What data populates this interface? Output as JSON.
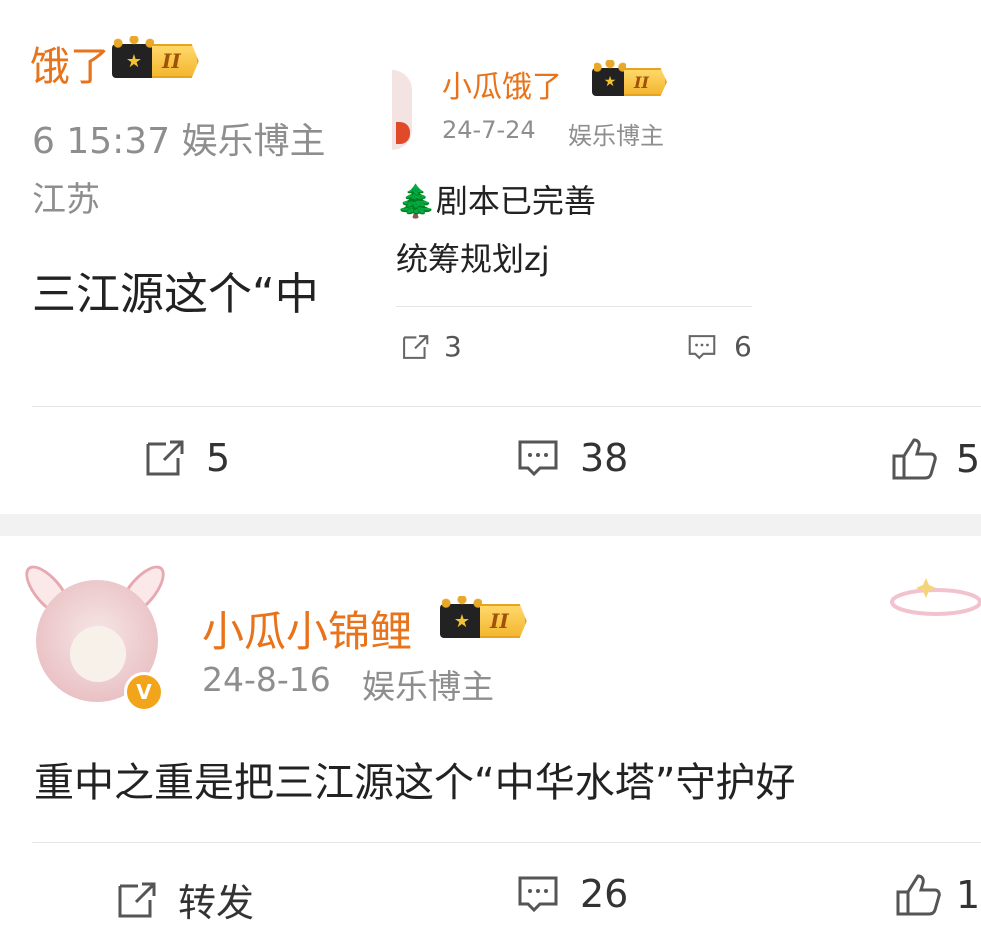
{
  "post1": {
    "name_fragment": "饿了",
    "badge_level": "II",
    "meta_fragment": "6 15:37  娱乐博主",
    "location_fragment": "江苏",
    "content_fragment": "三江源这个“中",
    "actions": {
      "repost_count": "5",
      "comment_count": "38",
      "like_count": "5"
    }
  },
  "overlay_post": {
    "username": "小瓜饿了",
    "badge_level": "II",
    "date": "24-7-24",
    "role": "娱乐博主",
    "line1": "剧本已完善",
    "line1_emoji": "🌲",
    "line2": "统筹规划zj",
    "repost_count": "3",
    "comment_count": "6"
  },
  "post2": {
    "username": "小瓜小锦鲤",
    "badge_level": "II",
    "date": "24-8-16",
    "role": "娱乐博主",
    "verified_mark": "V",
    "content": "重中之重是把三江源这个“中华水塔”守护好",
    "actions": {
      "repost_label": "转发",
      "comment_count": "26",
      "like_count": "1"
    }
  },
  "colors": {
    "username": "#e8731a",
    "meta": "#8e8e8e",
    "separator": "#f2f2f2"
  },
  "icons": [
    "repost-icon",
    "comment-icon",
    "like-icon",
    "crown-icon",
    "verified-icon",
    "tree-emoji",
    "avatar-rabbit",
    "decoration-sparkle-icon"
  ]
}
